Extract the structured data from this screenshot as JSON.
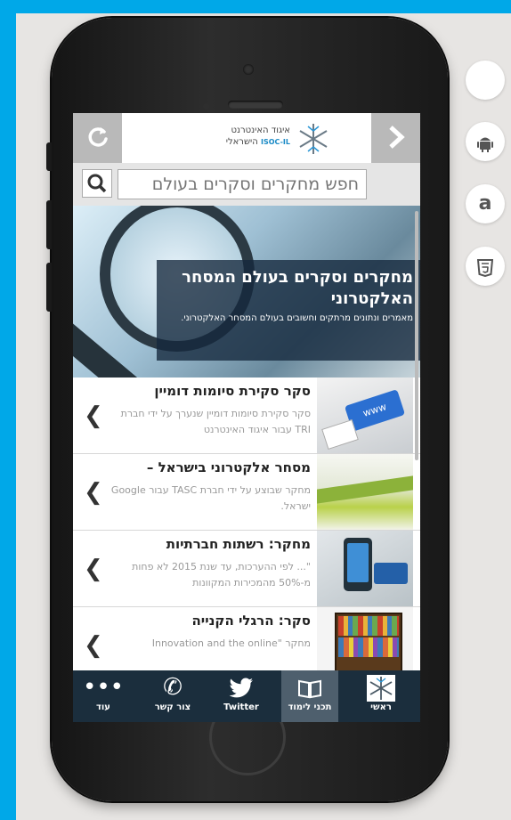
{
  "header": {
    "logo_line1": "איגוד האינטרנט",
    "logo_line2": "הישראלי",
    "logo_tag": "ISOC-IL",
    "back_icon": "chevron-right",
    "refresh_icon": "refresh"
  },
  "search": {
    "placeholder": "חפש מחקרים וסקרים בעולם"
  },
  "hero": {
    "title": "מחקרים וסקרים בעולם המסחר האלקטרוני",
    "subtitle": "מאמרים ונתונים מרתקים וחשובים בעולם המסחר האלקטרוני."
  },
  "items": [
    {
      "title": "סקר סקירת סיומות דומיין",
      "desc": "סקר סקירת סיומות דומיין שנערך על ידי חברת TRI עבור איגוד האינטרנט"
    },
    {
      "title": "מסחר אלקטרוני בישראל –",
      "desc": "מחקר שבוצע על ידי חברת TASC עבור Google ישראל."
    },
    {
      "title": "מחקר: רשתות חברתיות",
      "desc": "\"... לפי ההערכות, עד שנת 2015 לא פחות מ-50% מהמכירות המקוונות"
    },
    {
      "title": "סקר: הרגלי הקנייה",
      "desc": "מחקר \"Innovation and the online"
    }
  ],
  "tabs": [
    {
      "label": "ראשי",
      "icon": "snowflake-logo"
    },
    {
      "label": "תכני לימוד",
      "icon": "book"
    },
    {
      "label": "Twitter",
      "icon": "twitter-bird"
    },
    {
      "label": "צור קשר",
      "icon": "phone"
    },
    {
      "label": "עוד",
      "icon": "more-dots"
    }
  ],
  "stores": [
    "apple",
    "android",
    "amazon",
    "html5"
  ],
  "colors": {
    "background": "#00a8e8",
    "tabbar": "#1b2e3d",
    "tab_active": "#4e5f6d",
    "hero_box": "#14283c"
  }
}
